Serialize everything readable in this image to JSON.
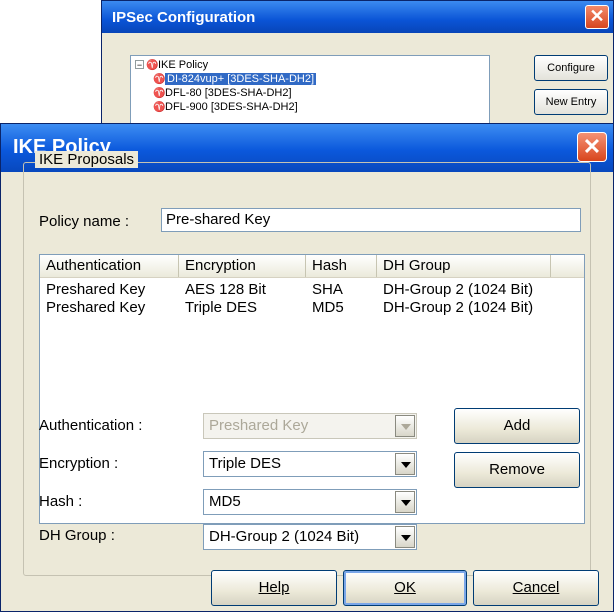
{
  "back_window": {
    "title": "IPSec Configuration",
    "tree": [
      {
        "label": "IKE Policy",
        "selected": false
      },
      {
        "label": "DI-824vup+ [3DES-SHA-DH2]",
        "selected": true
      },
      {
        "label": "DFL-80 [3DES-SHA-DH2]",
        "selected": false
      },
      {
        "label": "DFL-900 [3DES-SHA-DH2]",
        "selected": false
      }
    ],
    "buttons": {
      "configure": "Configure",
      "new_entry": "New Entry"
    }
  },
  "dialog": {
    "title": "IKE Policy",
    "group_label": "IKE Proposals",
    "policy_name_label": "Policy name :",
    "policy_name_value": "Pre-shared Key",
    "columns": [
      "Authentication",
      "Encryption",
      "Hash",
      "DH Group"
    ],
    "rows": [
      [
        "Preshared Key",
        "AES 128 Bit",
        "SHA",
        "DH-Group 2 (1024 Bit)"
      ],
      [
        "Preshared Key",
        "Triple DES",
        "MD5",
        "DH-Group 2 (1024 Bit)"
      ]
    ],
    "fields": {
      "authentication": {
        "label": "Authentication :",
        "value": "Preshared Key"
      },
      "encryption": {
        "label": "Encryption :",
        "value": "Triple DES"
      },
      "hash": {
        "label": "Hash :",
        "value": "MD5"
      },
      "dh_group": {
        "label": "DH Group :",
        "value": "DH-Group 2 (1024 Bit)"
      }
    },
    "buttons": {
      "add": "Add",
      "remove": "Remove",
      "help": "Help",
      "ok": "OK",
      "cancel": "Cancel"
    }
  },
  "colors": {
    "title_bar": "#0b58dc",
    "close_button": "#d8451d",
    "selection": "#316ac5",
    "dialog_bg": "#ece9d8"
  }
}
